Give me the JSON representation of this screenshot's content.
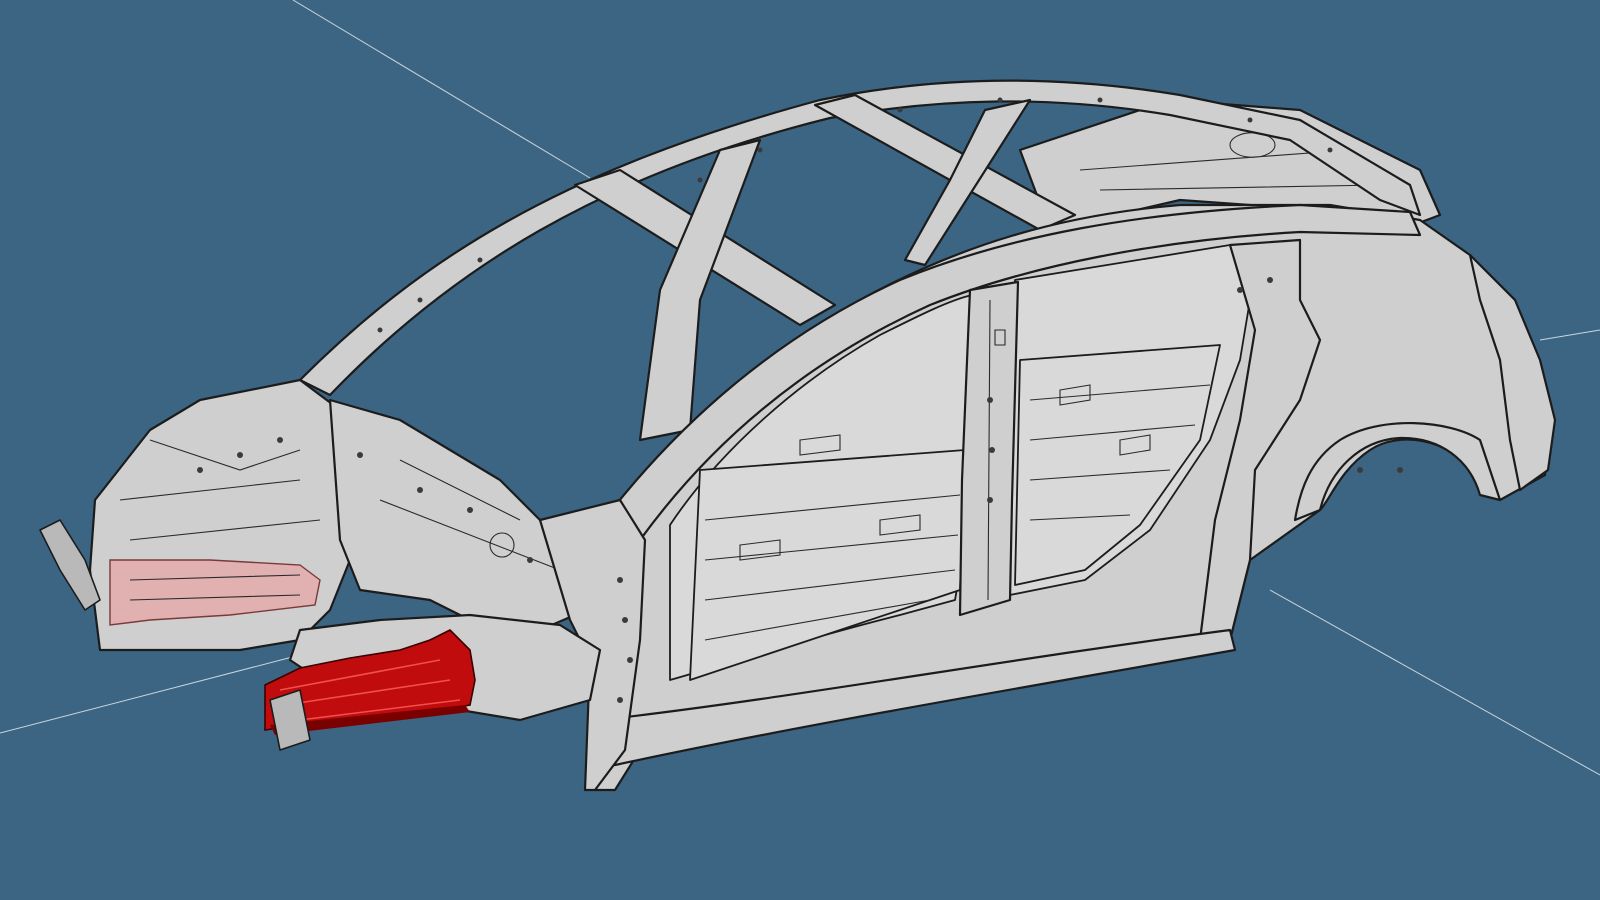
{
  "viewer": {
    "background": "#3b6583",
    "model": "body-in-white",
    "highlight_color": "#c00c0c",
    "highlight_ghost_color": "#e7a5a5",
    "selected_part": "front-left-frame-rail-extension",
    "ghosted_part": "front-right-frame-rail-extension"
  }
}
